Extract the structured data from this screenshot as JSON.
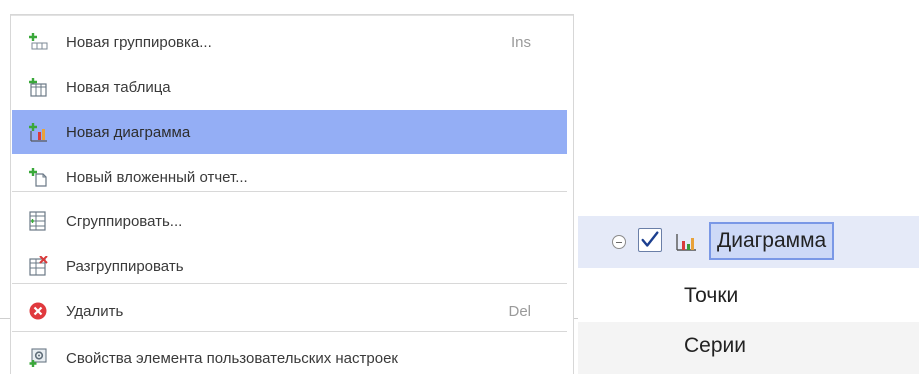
{
  "menu": {
    "items": [
      {
        "label": "Новая группировка...",
        "shortcut": "Ins",
        "icon": "new-grouping-icon"
      },
      {
        "label": "Новая таблица",
        "shortcut": "",
        "icon": "new-table-icon"
      },
      {
        "label": "Новая диаграмма",
        "shortcut": "",
        "icon": "new-chart-icon",
        "highlighted": true
      },
      {
        "label": "Новый вложенный отчет...",
        "shortcut": "",
        "icon": "new-nested-report-icon"
      },
      {
        "label": "Сгруппировать...",
        "shortcut": "",
        "icon": "group-icon"
      },
      {
        "label": "Разгруппировать",
        "shortcut": "",
        "icon": "ungroup-icon"
      },
      {
        "label": "Удалить",
        "shortcut": "Del",
        "icon": "delete-icon"
      },
      {
        "label": "Свойства элемента пользовательских настроек",
        "shortcut": "",
        "icon": "user-settings-properties-icon"
      }
    ],
    "highlight_color": "#94aef5"
  },
  "tree": {
    "selected": {
      "label": "Диаграмма",
      "checked": true,
      "icon": "chart-icon"
    },
    "children": [
      {
        "label": "Точки"
      },
      {
        "label": "Серии"
      }
    ]
  },
  "colors": {
    "selection_row": "#e5eaf8",
    "label_box": "#cdd9f7",
    "delete_red": "#e0393e",
    "add_green": "#3aa83a"
  }
}
